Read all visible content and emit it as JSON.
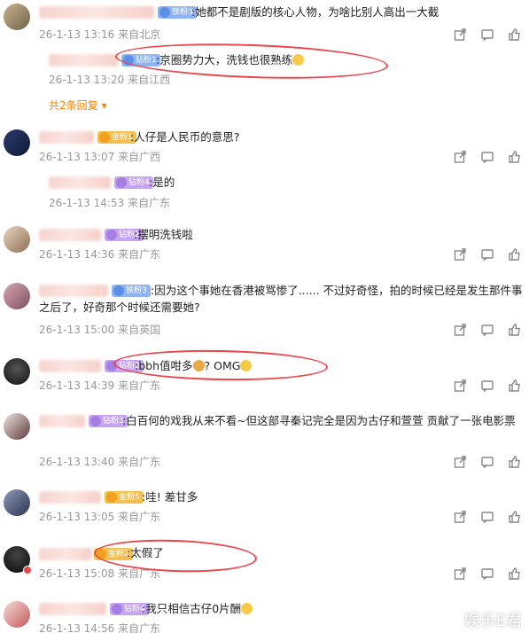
{
  "comments": [
    {
      "text": ":她都不是剧版的核心人物，为啥比别人高出一大截",
      "badge": "铁粉3",
      "time": "26-1-13 13:16",
      "loc": "来自北京"
    },
    {
      "text": ":京圈势力大，洗钱也很熟练",
      "badge": "钻粉1",
      "time": "26-1-13 13:20",
      "loc": "来自江西",
      "reply": true
    },
    {
      "text": ":人仔是人民币的意思?",
      "badge": "金粉1",
      "time": "26-1-13 13:07",
      "loc": "来自广西"
    },
    {
      "text": ":是的",
      "badge": "钻粉4",
      "time": "26-1-13 14:53",
      "loc": "来自广东",
      "reply": true
    },
    {
      "text": ":摆明洗钱啦",
      "badge": "钻粉2",
      "time": "26-1-13 14:36",
      "loc": "来自广东"
    },
    {
      "text": ":因为这个事她在香港被骂惨了...... 不过好奇怪，拍的时候已经是发生那件事之后了，好奇那个时候还需要她?",
      "badge": "铁粉3",
      "time": "26-1-13 15:00",
      "loc": "来自英国"
    },
    {
      "text": ":bbh值咁多",
      "text2": "? OMG",
      "badge": "钻粉3",
      "time": "26-1-13 14:39",
      "loc": "来自广东"
    },
    {
      "text": ":白百何的戏我从来不看~但这部寻秦记完全是因为古仔和萱萱 贡献了一张电影票",
      "badge": "钻粉3",
      "time": "26-1-13 13:40",
      "loc": "来自广东"
    },
    {
      "text": ":哇! 差甘多",
      "badge": "金粉5",
      "time": "26-1-13 13:05",
      "loc": "来自广东"
    },
    {
      "text": ":太假了",
      "badge": "金粉2",
      "time": "26-1-13 15:08",
      "loc": "来自广东"
    },
    {
      "text": ":我只相信古仔0片酬",
      "badge": "钻粉4",
      "time": "26-1-13 14:56",
      "loc": "来自广东"
    }
  ],
  "replies_toggle": "共2条回复",
  "watermark": "娱乐E君",
  "icons": [
    "share-icon",
    "comment-icon",
    "like-icon"
  ],
  "colors": {
    "accent": "#ff8200",
    "circle": "#e8464c",
    "meta": "#999999"
  }
}
